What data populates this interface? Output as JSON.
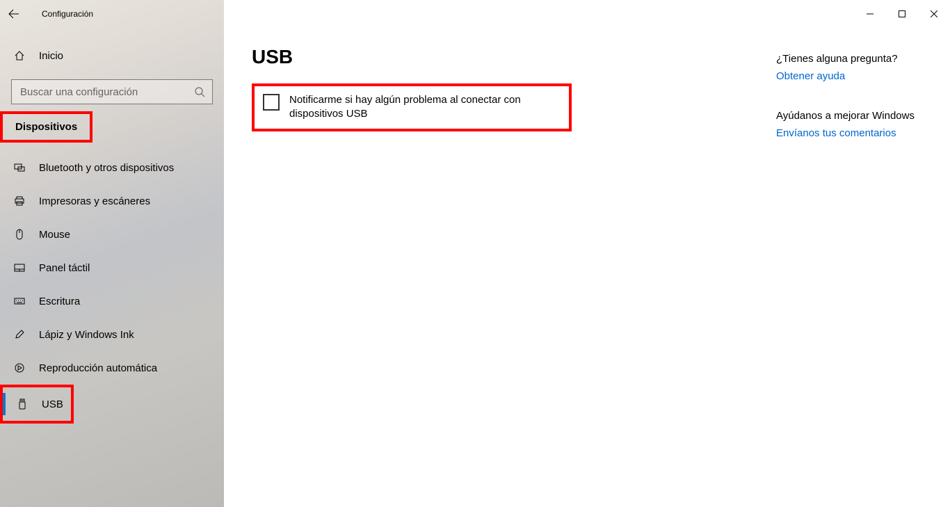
{
  "window": {
    "title": "Configuración"
  },
  "sidebar": {
    "home_label": "Inicio",
    "search_placeholder": "Buscar una configuración",
    "section_header": "Dispositivos",
    "items": [
      {
        "label": "Bluetooth y otros dispositivos"
      },
      {
        "label": "Impresoras y escáneres"
      },
      {
        "label": "Mouse"
      },
      {
        "label": "Panel táctil"
      },
      {
        "label": "Escritura"
      },
      {
        "label": "Lápiz y Windows Ink"
      },
      {
        "label": "Reproducción automática"
      },
      {
        "label": "USB"
      }
    ]
  },
  "main": {
    "title": "USB",
    "checkbox_label": "Notificarme si hay algún problema al conectar con dispositivos USB"
  },
  "right": {
    "q1": "¿Tienes alguna pregunta?",
    "link1": "Obtener ayuda",
    "q2": "Ayúdanos a mejorar Windows",
    "link2": "Envíanos tus comentarios"
  }
}
